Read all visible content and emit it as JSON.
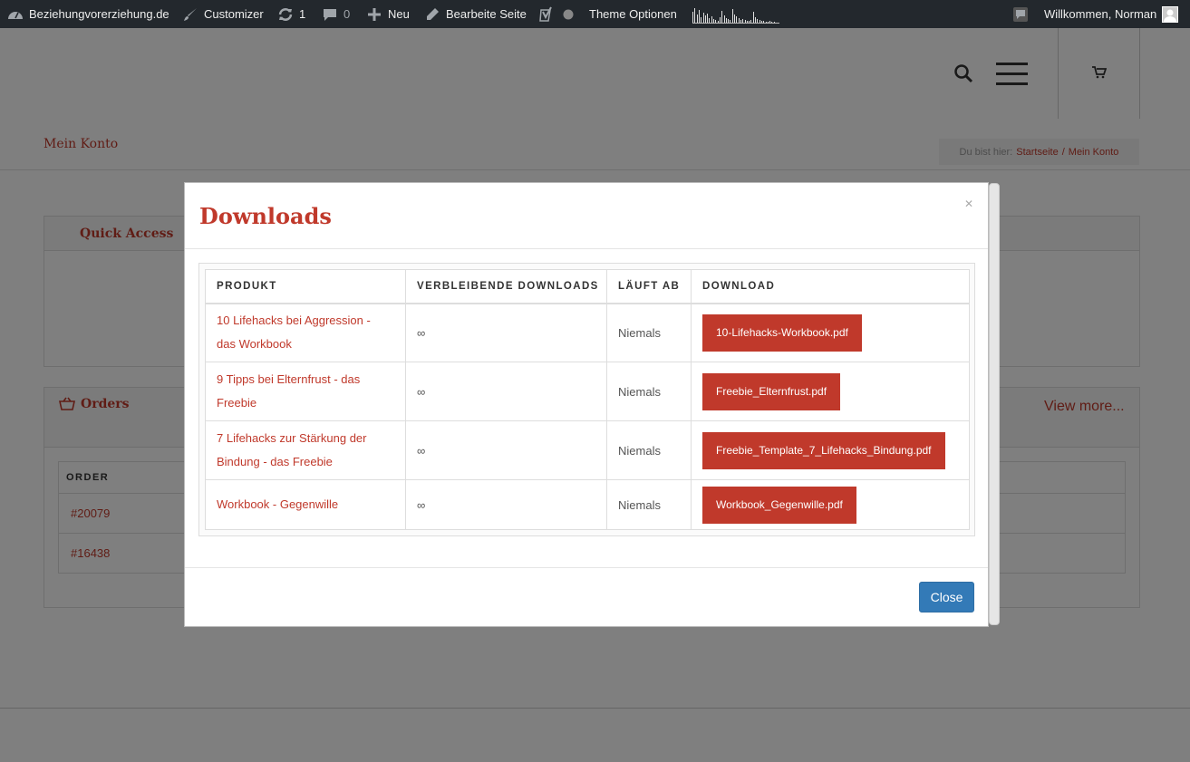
{
  "admin_bar": {
    "site_name": "Beziehungvorerziehung.de",
    "customizer": "Customizer",
    "updates_count": "1",
    "comments_count": "0",
    "new_label": "Neu",
    "edit_page": "Bearbeite Seite",
    "theme_options": "Theme Optionen",
    "welcome": "Willkommen, Norman"
  },
  "page": {
    "title": "Mein Konto",
    "breadcrumb_label": "Du bist hier:",
    "breadcrumb_home": "Startseite",
    "breadcrumb_separator": "/",
    "breadcrumb_current": "Mein Konto"
  },
  "quick_access": {
    "title": "Quick Access"
  },
  "orders": {
    "title": "Orders",
    "view_more": "View more...",
    "column_order": "ORDER",
    "rows": [
      "#20079",
      "#16438"
    ]
  },
  "modal": {
    "title": "Downloads",
    "columns": [
      "PRODUKT",
      "VERBLEIBENDE DOWNLOADS",
      "LÄUFT AB",
      "DOWNLOAD"
    ],
    "rows": [
      {
        "product": "10 Lifehacks bei Aggression - das Workbook",
        "remaining": "∞",
        "expires": "Niemals",
        "file": "10-Lifehacks-Workbook.pdf"
      },
      {
        "product": "9 Tipps bei Elternfrust - das Freebie",
        "remaining": "∞",
        "expires": "Niemals",
        "file": "Freebie_Elternfrust.pdf"
      },
      {
        "product": "7 Lifehacks zur Stärkung der Bindung - das Freebie",
        "remaining": "∞",
        "expires": "Niemals",
        "file": "Freebie_Template_7_Lifehacks_Bindung.pdf"
      },
      {
        "product": "Workbook - Gegenwille",
        "remaining": "∞",
        "expires": "Niemals",
        "file": "Workbook_Gegenwille.pdf"
      }
    ],
    "close_label": "Close"
  },
  "colors": {
    "accent": "#c0392b",
    "admin_bar": "#23282d",
    "close_button": "#337ab7"
  }
}
